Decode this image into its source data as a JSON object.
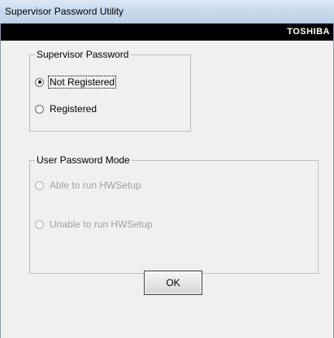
{
  "window": {
    "title": "Supervisor Password Utility",
    "brand": "TOSHIBA"
  },
  "supervisor_group": {
    "label": "Supervisor Password",
    "options": [
      {
        "label": "Not Registered",
        "selected": true,
        "enabled": true
      },
      {
        "label": "Registered",
        "selected": false,
        "enabled": true
      }
    ]
  },
  "user_mode_group": {
    "label": "User Password Mode",
    "options": [
      {
        "label": "Able to run HWSetup",
        "selected": false,
        "enabled": false
      },
      {
        "label": "Unable to run HWSetup",
        "selected": false,
        "enabled": false
      }
    ]
  },
  "buttons": {
    "ok_label": "OK"
  },
  "colors": {
    "brand_bar": "#000000",
    "brand_text": "#ffffff",
    "dialog_background": "#f0f0f0",
    "disabled_text": "#a0a0a0"
  }
}
